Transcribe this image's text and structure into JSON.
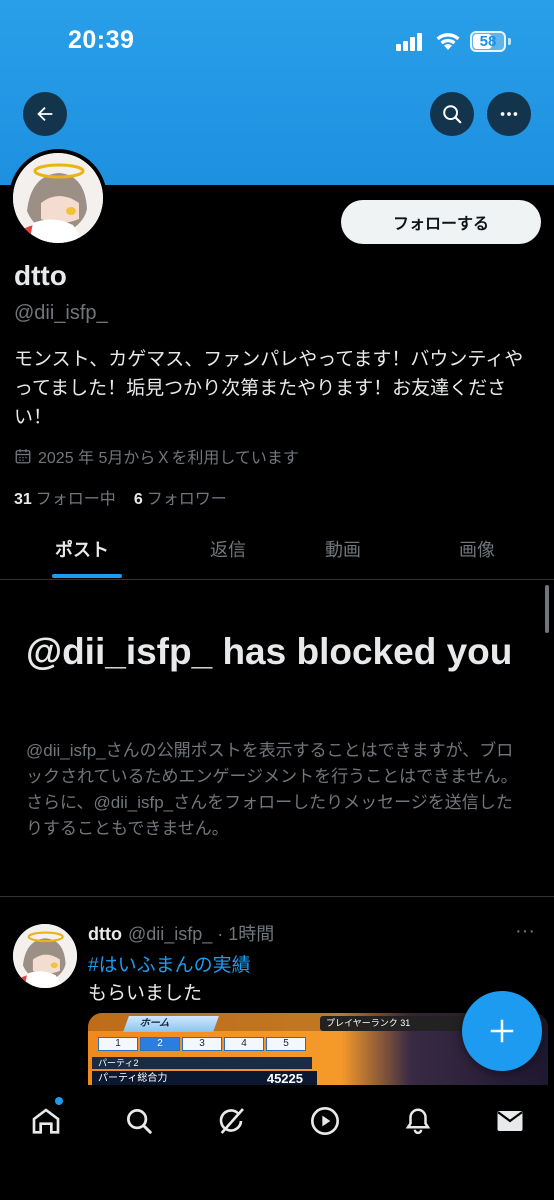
{
  "status_bar": {
    "time": "20:39",
    "battery": "58"
  },
  "header": {
    "back_icon": "arrow-left-icon",
    "search_icon": "search-icon",
    "more_icon": "more-horizontal-icon"
  },
  "profile": {
    "follow_label": "フォローする",
    "display_name": "dtto",
    "handle": "@dii_isfp_",
    "bio": "モンスト、カゲマス、ファンパレやってます！バウンティやってました！垢見つかり次第またやります！お友達ください！",
    "joined": "2025 年 5月からＸを利用しています",
    "following_count": "31",
    "following_label": "フォロー中",
    "followers_count": "6",
    "followers_label": "フォロワー"
  },
  "tabs": [
    {
      "label": "ポスト",
      "active": true
    },
    {
      "label": "返信",
      "active": false
    },
    {
      "label": "動画",
      "active": false
    },
    {
      "label": "画像",
      "active": false
    }
  ],
  "blocked": {
    "title": "@dii_isfp_ has blocked you",
    "description": "@dii_isfp_さんの公開ポストを表示することはできますが、ブロックされているためエンゲージメントを行うことはできません。さらに、@dii_isfp_さんをフォローしたりメッセージを送信したりすることもできません。"
  },
  "post": {
    "name": "dtto",
    "handle_time": "@dii_isfp_ · 1時間",
    "more": "···",
    "hashtag": "#はいふまんの実績",
    "text": "もらいました",
    "image": {
      "home_label": "ホーム",
      "rank_label": "プレイヤーランク",
      "rank_value": "31",
      "slots": [
        "1",
        "2",
        "3",
        "4",
        "5"
      ],
      "selected_slot": "2",
      "party_label": "パーティ2",
      "power_label": "パーティ総合力",
      "power_value": "45225"
    }
  },
  "colors": {
    "accent": "#1d9bf0",
    "banner": "#1d90e0",
    "background": "#000000",
    "muted_text": "#71767b"
  },
  "bottom_nav": {
    "items": [
      "home-icon",
      "search-icon",
      "grok-icon",
      "video-icon",
      "notifications-icon",
      "messages-icon"
    ]
  }
}
